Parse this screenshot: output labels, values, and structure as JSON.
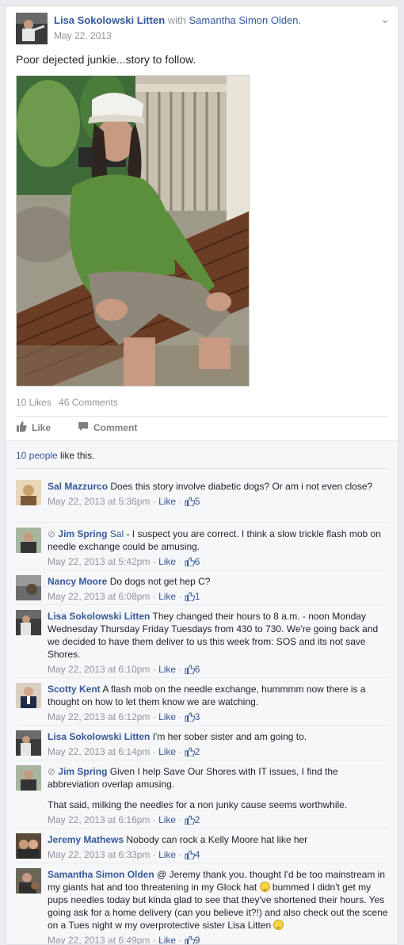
{
  "post": {
    "author": "Lisa Sokolowski Litten",
    "with_text": "with",
    "tagged": "Samantha Simon Olden.",
    "date": "May 22, 2013",
    "text": "Poor dejected junkie...story to follow.",
    "likes": "10 Likes",
    "comments": "46 Comments",
    "like_label": "Like",
    "comment_label": "Comment",
    "likers_link": "10 people",
    "likers_rest": " like this.",
    "chevron": "⌄"
  },
  "ui": {
    "middot": " · ",
    "like_action": "Like"
  },
  "comments": [
    {
      "name": "Sal Mazzurco",
      "text": "Does this story involve diabetic dogs? Or am i not even close?",
      "time": "May 22, 2013 at 5:36pm",
      "likes": "5"
    },
    {
      "reply_icon": "⊘",
      "name": "Jim Spring",
      "mention": "Sal",
      "text": " - I suspect you are correct. I think a slow trickle flash mob on needle exchange could be amusing.",
      "time": "May 22, 2013 at 5:42pm",
      "likes": "6"
    },
    {
      "name": "Nancy Moore",
      "text": "Do dogs not get hep C?",
      "time": "May 22, 2013 at 6:08pm",
      "likes": "1"
    },
    {
      "name": "Lisa Sokolowski Litten",
      "text": "They changed their hours to 8 a.m. - noon Monday Wednesday Thursday Friday Tuesdays from 430 to 730. We're going back and we decided to have them deliver to us this week from: SOS and its not save Shores.",
      "time": "May 22, 2013 at 6:10pm",
      "likes": "6"
    },
    {
      "name": "Scotty Kent",
      "text": "A flash mob on the needle exchange, hummmm now there is a thought on how to let them know we are watching.",
      "time": "May 22, 2013 at 6:12pm",
      "likes": "3"
    },
    {
      "name": "Lisa Sokolowski Litten",
      "text": "I'm her sober sister and am going to.",
      "time": "May 22, 2013 at 6:14pm",
      "likes": "2"
    },
    {
      "reply_icon": "⊘",
      "name": "Jim Spring",
      "text": "Given I help Save Our Shores with IT issues, I find the abbreviation overlap amusing.",
      "text2": "That said, milking the needles for a non junky cause seems worthwhile.",
      "time": "May 22, 2013 at 6:16pm",
      "likes": "2"
    },
    {
      "name": "Jeremy Mathews",
      "text": "Nobody can rock a Kelly Moore hat like her",
      "time": "May 22, 2013 at 6:33pm",
      "likes": "4"
    },
    {
      "name": "Samantha Simon Olden",
      "text_a": "@ Jeremy thank you. thought I'd be too mainstream in my giants hat and too threatening in my Glock hat",
      "text_b": " bummed I didn't get my pups needles today but kinda glad to see that they've shortened their hours. Yes going ask for a home delivery (can you believe it?!) and also check out the scene on a Tues night w my overprotective sister Lisa Litten",
      "time": "May 22, 2013 at 6:49pm",
      "likes": "9"
    }
  ],
  "colors": {
    "link": "#365899",
    "meta": "#90949c",
    "bg": "#e9ebee"
  }
}
